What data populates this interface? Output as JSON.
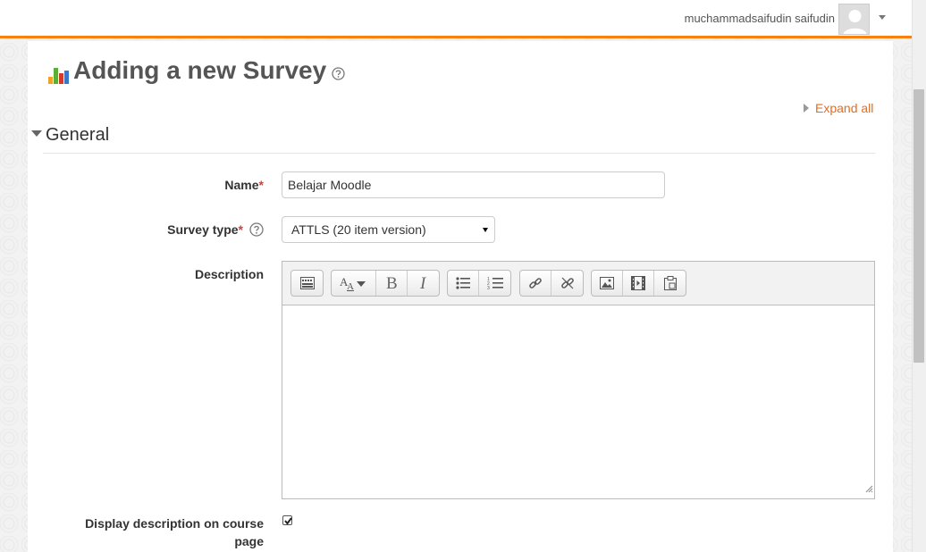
{
  "header": {
    "user_name": "muchammadsaifudin saifudin"
  },
  "page": {
    "title": "Adding a new Survey",
    "expand_all": "Expand all"
  },
  "section": {
    "general_label": "General"
  },
  "form": {
    "name_label": "Name",
    "name_value": "Belajar Moodle",
    "survey_type_label": "Survey type",
    "survey_type_value": "ATTLS (20 item version)",
    "description_label": "Description",
    "display_description_label_line1": "Display description on course",
    "display_description_label_line2": "page",
    "display_description_checked": true,
    "required_marker": "*"
  },
  "editor_toolbar": [
    [
      "toolbar-toggle-icon"
    ],
    [
      "font-size-icon",
      "bold-icon",
      "italic-icon"
    ],
    [
      "unordered-list-icon",
      "ordered-list-icon"
    ],
    [
      "link-icon",
      "unlink-icon"
    ],
    [
      "image-icon",
      "media-icon",
      "manage-files-icon"
    ]
  ],
  "colors": {
    "accent": "#f98012",
    "link": "#e56c1f",
    "required": "#b94a48"
  }
}
